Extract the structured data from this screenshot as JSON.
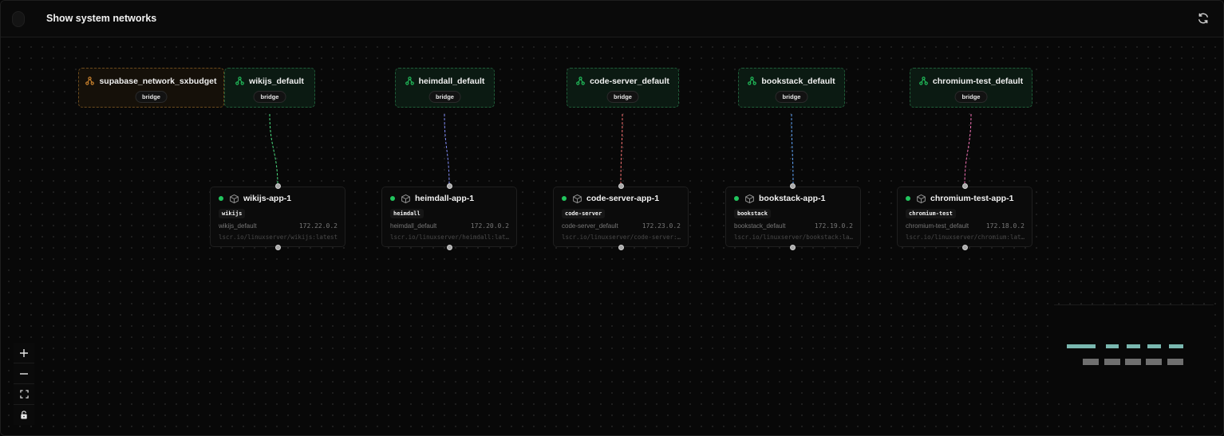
{
  "header": {
    "title": "Show system networks",
    "refresh_icon": "refresh-icon"
  },
  "networks": [
    {
      "name": "supabase_network_sxbudget",
      "driver": "bridge",
      "accent": "#d4882f"
    },
    {
      "name": "wikijs_default",
      "driver": "bridge",
      "accent": "#22c55e"
    },
    {
      "name": "heimdall_default",
      "driver": "bridge",
      "accent": "#22c55e"
    },
    {
      "name": "code-server_default",
      "driver": "bridge",
      "accent": "#22c55e"
    },
    {
      "name": "bookstack_default",
      "driver": "bridge",
      "accent": "#22c55e"
    },
    {
      "name": "chromium-test_default",
      "driver": "bridge",
      "accent": "#22c55e"
    }
  ],
  "containers": [
    {
      "name": "wikijs-app-1",
      "tag": "wikijs",
      "network": "wikijs_default",
      "ip": "172.22.0.2",
      "image": "lscr.io/linuxserver/wikijs:latest",
      "edge_color": "#4ade80"
    },
    {
      "name": "heimdall-app-1",
      "tag": "heimdall",
      "network": "heimdall_default",
      "ip": "172.20.0.2",
      "image": "lscr.io/linuxserver/heimdall:latest",
      "edge_color": "#818cf8"
    },
    {
      "name": "code-server-app-1",
      "tag": "code-server",
      "network": "code-server_default",
      "ip": "172.23.0.2",
      "image": "lscr.io/linuxserver/code-server:latest",
      "edge_color": "#f87171"
    },
    {
      "name": "bookstack-app-1",
      "tag": "bookstack",
      "network": "bookstack_default",
      "ip": "172.19.0.2",
      "image": "lscr.io/linuxserver/bookstack:latest",
      "edge_color": "#60a5fa"
    },
    {
      "name": "chromium-test-app-1",
      "tag": "chromium-test",
      "network": "chromium-test_default",
      "ip": "172.18.0.2",
      "image": "lscr.io/linuxserver/chromium:latest",
      "edge_color": "#f472b6"
    }
  ],
  "controls": {
    "zoom_in_icon": "plus-icon",
    "zoom_out_icon": "minus-icon",
    "fit_view_icon": "fit-view-icon",
    "lock_icon": "lock-icon"
  },
  "colors": {
    "status_running": "#22c55e",
    "minimap_network": "#7ab8b0",
    "minimap_container": "#6f6f6f"
  }
}
